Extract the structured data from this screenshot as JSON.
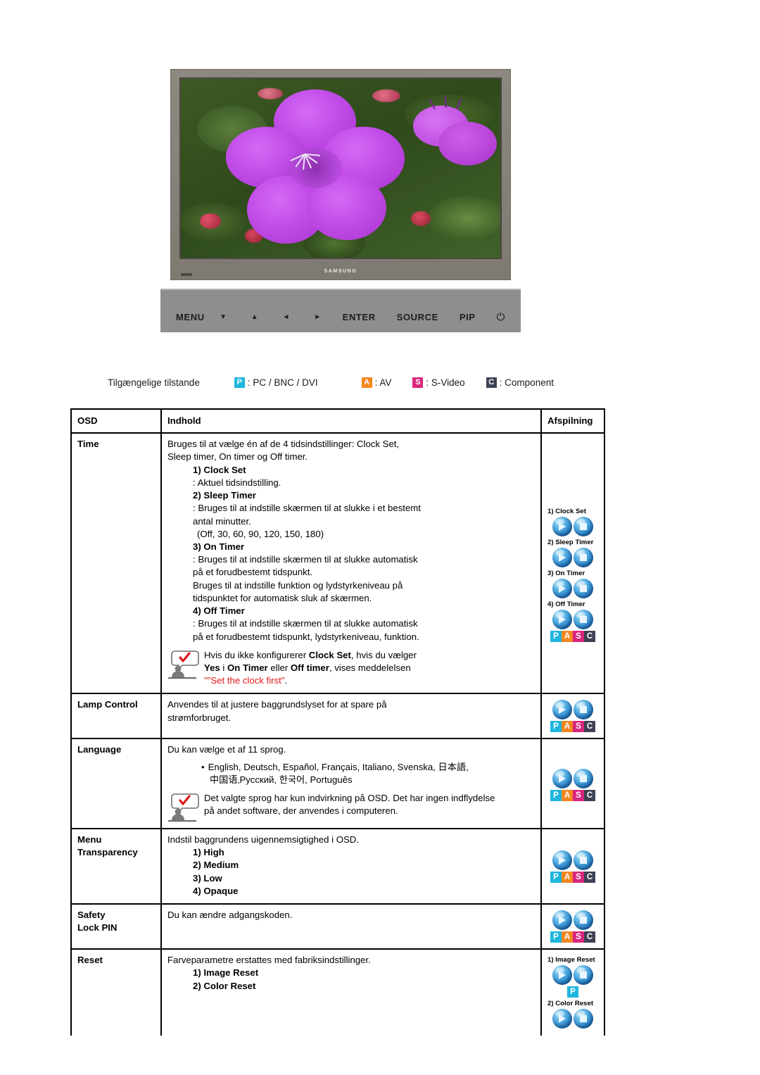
{
  "monitor": {
    "brand": "SAMSUNG",
    "screen_subject": "purple flower on green foliage",
    "controls": [
      {
        "label": "MENU",
        "kind": "text"
      },
      {
        "label": "▼",
        "kind": "arrow"
      },
      {
        "label": "▲",
        "kind": "arrow"
      },
      {
        "label": "◄",
        "kind": "arrow"
      },
      {
        "label": "►",
        "kind": "arrow"
      },
      {
        "label": "ENTER",
        "kind": "text"
      },
      {
        "label": "SOURCE",
        "kind": "text"
      },
      {
        "label": "PIP",
        "kind": "text"
      },
      {
        "label": "⏻",
        "kind": "power"
      }
    ]
  },
  "legend": {
    "label": "Tilgængelige tilstande",
    "items": [
      {
        "badge": "P",
        "color": "#1fb6dd",
        "text": ": PC / BNC / DVI"
      },
      {
        "badge": "A",
        "color": "#f3861f",
        "text": ": AV"
      },
      {
        "badge": "S",
        "color": "#d9267e",
        "text": ": S-Video"
      },
      {
        "badge": "C",
        "color": "#3f4254",
        "text": ": Component"
      }
    ]
  },
  "table": {
    "headers": {
      "osd": "OSD",
      "indhold": "Indhold",
      "afspilning": "Afspilning"
    },
    "rows": {
      "time": {
        "osd": "Time",
        "intro_line1": "Bruges til at vælge én af de 4 tidsindstillinger: Clock Set,",
        "intro_line2": "Sleep timer, On timer og Off timer.",
        "item1_title": "1) Clock Set",
        "item1_desc": ": Aktuel tidsindstilling.",
        "item2_title": "2) Sleep Timer",
        "item2_desc_l1": ": Bruges til at indstille skærmen til at slukke i et bestemt",
        "item2_desc_l2": "antal minutter.",
        "item2_values": "(Off, 30, 60, 90, 120, 150, 180)",
        "item3_title": "3) On Timer",
        "item3_desc_l1": ": Bruges til at indstille skærmen til at slukke automatisk",
        "item3_desc_l2": "på et forudbestemt tidspunkt.",
        "item3_desc_l3": "Bruges til at indstille funktion og lydstyrkeniveau på",
        "item3_desc_l4": "tidspunktet for automatisk sluk af skærmen.",
        "item4_title": "4) Off Timer",
        "item4_desc_l1": ": Bruges til at indstille skærmen til at slukke automatisk",
        "item4_desc_l2": "på et forudbestemt tidspunkt, lydstyrkeniveau, funktion.",
        "note_l1_a": "Hvis du ikke konfigurerer ",
        "note_l1_b": "Clock Set",
        "note_l1_c": ", hvis du vælger",
        "note_l2_a": "Yes",
        "note_l2_b": " i ",
        "note_l2_c": "On Timer",
        "note_l2_d": " eller ",
        "note_l2_e": "Off timer",
        "note_l2_f": ", vises meddelelsen",
        "note_l3_red": "\"\"Set the clock first\"",
        "note_l3_tail": ".",
        "icons": [
          {
            "caption": "1) Clock Set"
          },
          {
            "caption": "2) Sleep Timer"
          },
          {
            "caption": "3) On Timer"
          },
          {
            "caption": "4) Off Timer"
          }
        ],
        "badges": "PASC"
      },
      "lamp_control": {
        "osd": "Lamp Control",
        "desc_l1": "Anvendes til at justere baggrundslyset for at spare på",
        "desc_l2": "strømforbruget.",
        "badges": "PASC"
      },
      "language": {
        "osd": "Language",
        "desc": "Du kan vælge et af 11 sprog.",
        "list_line1": "English, Deutsch, Español, Français, Italiano, Svenska, 日本語,",
        "list_line2": "中国语‚Русский, 한국어,  Português",
        "note_l1": "Det valgte sprog har kun indvirkning på OSD. Det har ingen indflydelse",
        "note_l2": "på andet software, der anvendes i computeren.",
        "badges": "PASC"
      },
      "menu_transparency": {
        "osd_l1": "Menu",
        "osd_l2": "Transparency",
        "desc": "Indstil baggrundens uigennemsigtighed i OSD.",
        "opt1": "1) High",
        "opt2": "2) Medium",
        "opt3": "3) Low",
        "opt4": "4) Opaque",
        "badges": "PASC"
      },
      "safety_lock_pin": {
        "osd_l1": "Safety",
        "osd_l2": "Lock PIN",
        "desc": "Du kan ændre adgangskoden.",
        "badges": "PASC"
      },
      "reset": {
        "osd": "Reset",
        "desc": "Farveparametre erstattes med fabriksindstillinger.",
        "opt1": "1) Image Reset",
        "opt2": "2) Color Reset",
        "icon1_caption": "1) Image Reset",
        "icon1_badge": "P",
        "icon2_caption": "2) Color Reset"
      }
    }
  },
  "icons": {
    "play": "play-icon",
    "stop": "stop-icon",
    "note": "note-person-icon"
  }
}
